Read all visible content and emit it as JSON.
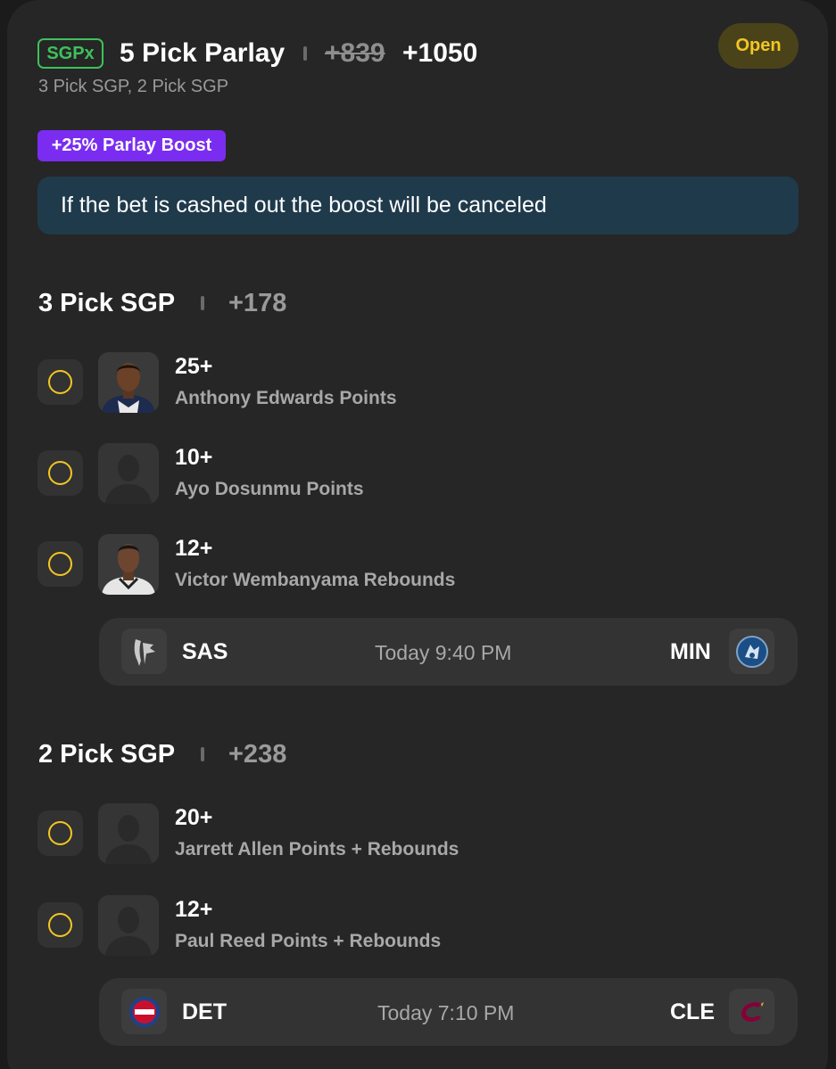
{
  "header": {
    "badge": "SGPx",
    "title": "5 Pick Parlay",
    "old_odds": "+839",
    "new_odds": "+1050",
    "subtitle": "3 Pick SGP, 2 Pick SGP",
    "status": "Open"
  },
  "boost": {
    "badge": "+25% Parlay Boost",
    "notice": "If the bet is cashed out the boost will be canceled"
  },
  "sections": [
    {
      "title": "3 Pick SGP",
      "odds": "+178",
      "picks": [
        {
          "line": "25+",
          "market": "Anthony Edwards Points",
          "avatar": "player-photo"
        },
        {
          "line": "10+",
          "market": "Ayo Dosunmu Points",
          "avatar": "placeholder-silhouette"
        },
        {
          "line": "12+",
          "market": "Victor Wembanyama Rebounds",
          "avatar": "player-photo"
        }
      ],
      "game": {
        "home": "SAS",
        "time": "Today 9:40 PM",
        "away": "MIN",
        "home_logo": "spurs-logo-icon",
        "away_logo": "timberwolves-logo-icon"
      }
    },
    {
      "title": "2 Pick SGP",
      "odds": "+238",
      "picks": [
        {
          "line": "20+",
          "market": "Jarrett Allen Points + Rebounds",
          "avatar": "placeholder-silhouette"
        },
        {
          "line": "12+",
          "market": "Paul Reed Points + Rebounds",
          "avatar": "placeholder-silhouette"
        }
      ],
      "game": {
        "home": "DET",
        "time": "Today 7:10 PM",
        "away": "CLE",
        "home_logo": "pistons-logo-icon",
        "away_logo": "cavaliers-logo-icon"
      }
    }
  ],
  "colors": {
    "background": "#262626",
    "accent_yellow": "#f3c622",
    "sgpx_green": "#3ec15a",
    "boost_purple": "#7a2df0",
    "notice_blue": "#1f3a4b"
  }
}
